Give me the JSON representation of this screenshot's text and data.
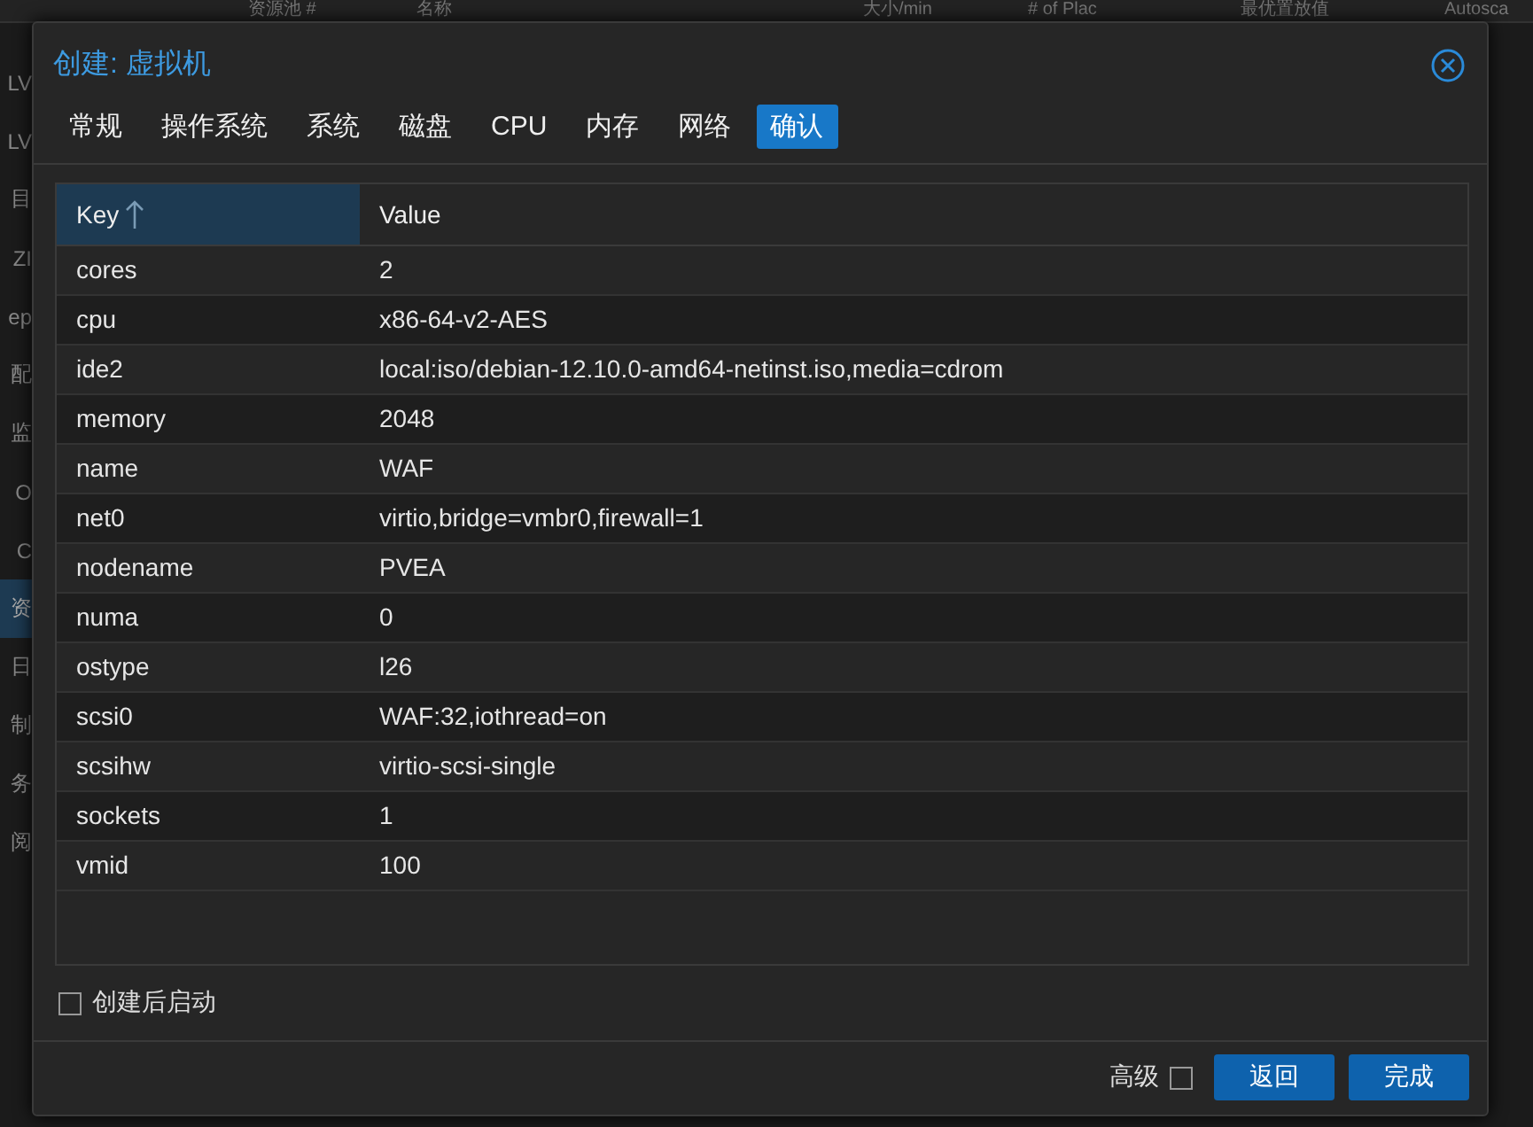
{
  "background": {
    "columns": [
      "资源池 #",
      "名称",
      "大小/min",
      "# of Plac",
      "最优置放值",
      "Autosca"
    ],
    "sidebar": [
      {
        "label": "LV",
        "selected": false
      },
      {
        "label": "LV",
        "selected": false
      },
      {
        "label": "目",
        "selected": false
      },
      {
        "label": "ZI",
        "selected": false
      },
      {
        "label": "ep",
        "selected": false
      },
      {
        "label": "配",
        "selected": false
      },
      {
        "label": "监",
        "selected": false
      },
      {
        "label": "O",
        "selected": false
      },
      {
        "label": "C",
        "selected": false
      },
      {
        "label": "资",
        "selected": true
      },
      {
        "label": "日",
        "selected": false
      },
      {
        "label": "制",
        "selected": false
      },
      {
        "label": "务",
        "selected": false
      },
      {
        "label": "阅",
        "selected": false
      }
    ]
  },
  "dialog": {
    "title": "创建: 虚拟机",
    "tabs": [
      {
        "label": "常规",
        "selected": false
      },
      {
        "label": "操作系统",
        "selected": false
      },
      {
        "label": "系统",
        "selected": false
      },
      {
        "label": "磁盘",
        "selected": false
      },
      {
        "label": "CPU",
        "selected": false
      },
      {
        "label": "内存",
        "selected": false
      },
      {
        "label": "网络",
        "selected": false
      },
      {
        "label": "确认",
        "selected": true
      }
    ],
    "table": {
      "columns": [
        {
          "label": "Key",
          "sorted": true
        },
        {
          "label": "Value",
          "sorted": false
        }
      ],
      "rows": [
        {
          "key": "cores",
          "value": "2"
        },
        {
          "key": "cpu",
          "value": "x86-64-v2-AES"
        },
        {
          "key": "ide2",
          "value": "local:iso/debian-12.10.0-amd64-netinst.iso,media=cdrom"
        },
        {
          "key": "memory",
          "value": "2048"
        },
        {
          "key": "name",
          "value": "WAF"
        },
        {
          "key": "net0",
          "value": "virtio,bridge=vmbr0,firewall=1"
        },
        {
          "key": "nodename",
          "value": "PVEA"
        },
        {
          "key": "numa",
          "value": "0"
        },
        {
          "key": "ostype",
          "value": "l26"
        },
        {
          "key": "scsi0",
          "value": "WAF:32,iothread=on"
        },
        {
          "key": "scsihw",
          "value": "virtio-scsi-single"
        },
        {
          "key": "sockets",
          "value": "1"
        },
        {
          "key": "vmid",
          "value": "100"
        }
      ]
    },
    "start_after_create": {
      "label": "创建后启动",
      "checked": false
    },
    "advanced": {
      "label": "高级",
      "checked": false
    },
    "buttons": [
      {
        "label": "返回",
        "kind": "primary"
      },
      {
        "label": "完成",
        "kind": "primary"
      }
    ]
  }
}
